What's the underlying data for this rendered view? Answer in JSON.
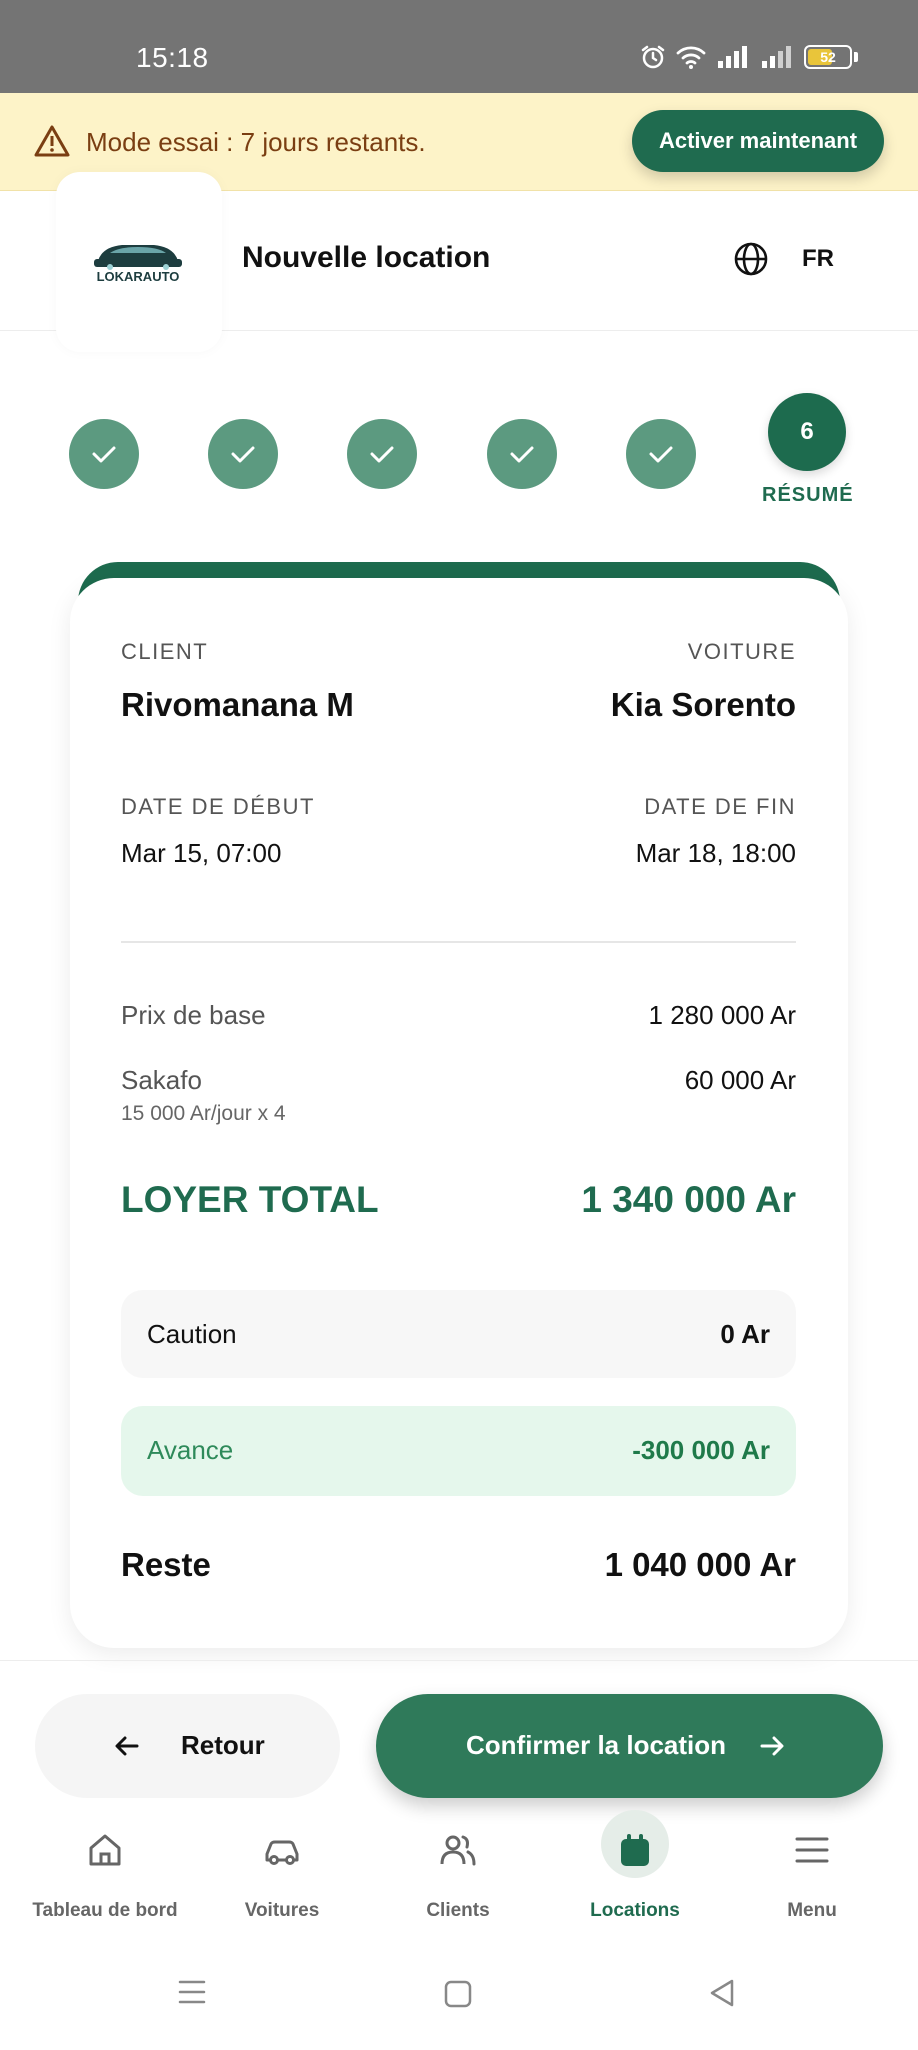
{
  "status_bar": {
    "time": "15:18",
    "battery": "52"
  },
  "trial_banner": {
    "message": "Mode essai : 7 jours restants.",
    "button_label": "Activer maintenant",
    "warning_color": "#7a3e12"
  },
  "header": {
    "logo_text": "LOKARAUTO",
    "title": "Nouvelle location",
    "language": "FR"
  },
  "stepper": {
    "completed_steps": 5,
    "active_step_number": "6",
    "active_step_label": "RÉSUMÉ",
    "accent_color": "#1f6b4f"
  },
  "summary": {
    "client_label": "CLIENT",
    "client_name": "Rivomanana M",
    "car_label": "VOITURE",
    "car_name": "Kia Sorento",
    "start_label": "DATE DE DÉBUT",
    "start_date": "Mar 15, 07:00",
    "end_label": "DATE DE FIN",
    "end_date": "Mar 18, 18:00",
    "base_price_label": "Prix de base",
    "base_price_value": "1 280 000 Ar",
    "extra_label": "Sakafo",
    "extra_detail": "15 000 Ar/jour x 4",
    "extra_value": "60 000 Ar",
    "total_label": "LOYER TOTAL",
    "total_value": "1 340 000 Ar",
    "deposit_label": "Caution",
    "deposit_value": "0 Ar",
    "advance_label": "Avance",
    "advance_value": "-300 000 Ar",
    "remaining_label": "Reste",
    "remaining_value": "1 040 000 Ar"
  },
  "actions": {
    "back_label": "Retour",
    "confirm_label": "Confirmer la location"
  },
  "bottom_nav": {
    "items": [
      {
        "label": "Tableau de bord",
        "icon": "home-icon"
      },
      {
        "label": "Voitures",
        "icon": "car-icon"
      },
      {
        "label": "Clients",
        "icon": "users-icon"
      },
      {
        "label": "Locations",
        "icon": "calendar-icon",
        "active": true
      },
      {
        "label": "Menu",
        "icon": "menu-icon"
      }
    ]
  }
}
